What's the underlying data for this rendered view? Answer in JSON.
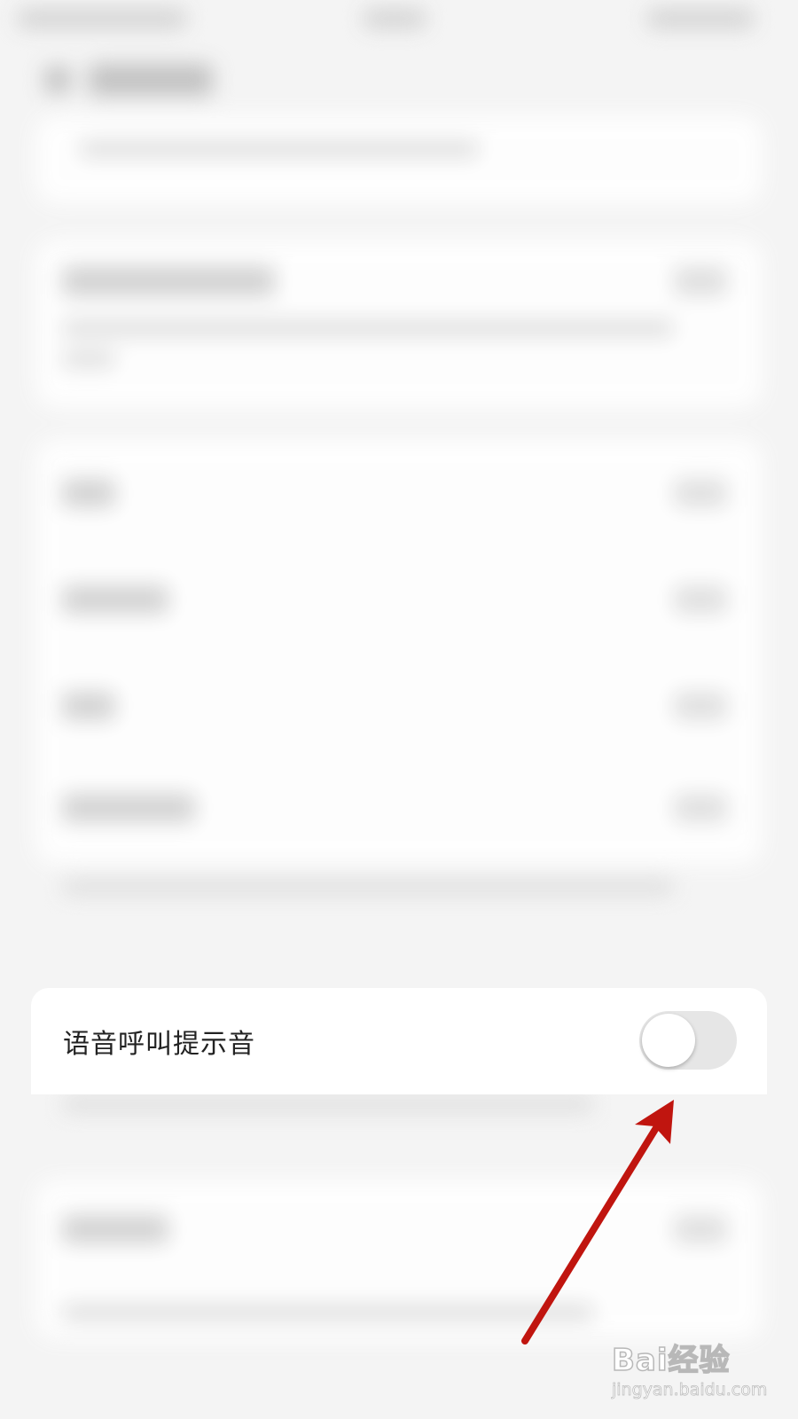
{
  "settings": {
    "voice_call_tone_label": "语音呼叫提示音",
    "voice_call_tone_enabled": false
  },
  "watermark": {
    "brand": "Bai经验",
    "url": "jingyan.baidu.com"
  },
  "colors": {
    "arrow": "#c0150f",
    "toggle_off": "#e6e6e6",
    "card": "#ffffff"
  }
}
